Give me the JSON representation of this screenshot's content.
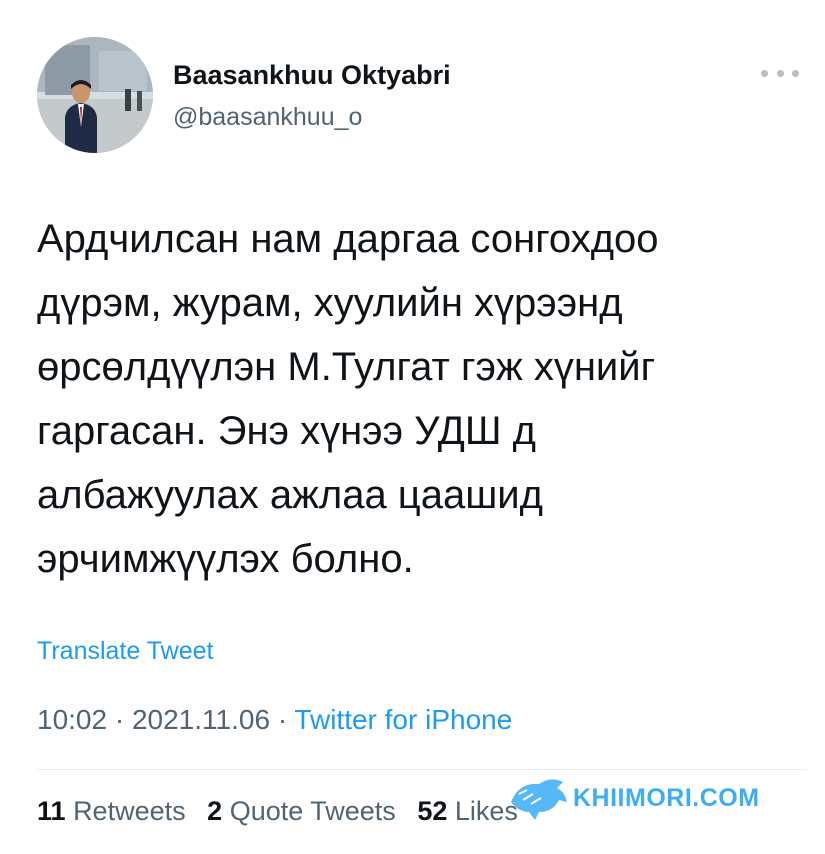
{
  "author": {
    "name": "Baasankhuu Oktyabri",
    "handle": "@baasankhuu_o",
    "avatar_icon": "profile-photo"
  },
  "tweet": {
    "lines": [
      "Ардчилсан нам даргаа сонгохдоо",
      "дүрэм, журам, хуулийн хүрээнд",
      "өрсөлдүүлэн М.Тулгат гэж хүнийг",
      "гаргасан. Энэ хүнээ УДШ д",
      "албажуулах ажлаа цаашид",
      "эрчимжүүлэх болно."
    ]
  },
  "translate_label": "Translate Tweet",
  "meta": {
    "time": "10:02",
    "separator": "·",
    "date": "2021.11.06",
    "source": "Twitter for iPhone"
  },
  "stats": {
    "retweets_count": "11",
    "retweets_label": "Retweets",
    "quotes_count": "2",
    "quotes_label": "Quote Tweets",
    "likes_count": "52",
    "likes_label": "Likes"
  },
  "watermark": {
    "text": "KHIIMORI.COM",
    "color": "#1da1f2"
  },
  "colors": {
    "text": "#0f1419",
    "secondary": "#536471",
    "link": "#1d9bf0",
    "divider": "#e6ecf0"
  }
}
